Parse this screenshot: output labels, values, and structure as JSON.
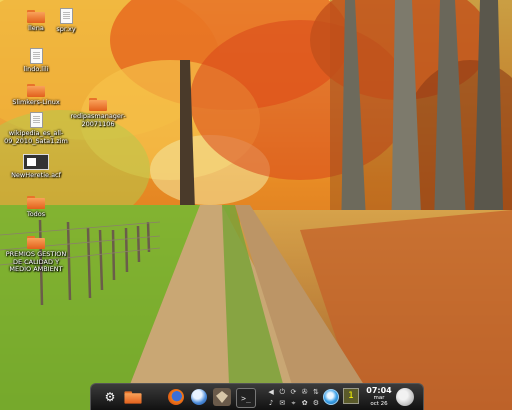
{
  "desktop": {
    "icons": [
      {
        "name": "folder-icon",
        "label": "llena"
      },
      {
        "name": "document-icon",
        "label": "spr.xy"
      },
      {
        "name": "document-icon",
        "label": "lindo.lili"
      },
      {
        "name": "folder-icon",
        "label": "Slimkers-Linux"
      },
      {
        "name": "document-icon",
        "label": "wikipedia_es_all-09_2010_Sata1.zim"
      },
      {
        "name": "folder-icon",
        "label": "redipasmanager-20071106"
      },
      {
        "name": "application-icon",
        "label": "NewHeretie.acf"
      },
      {
        "name": "folder-icon",
        "label": "Todos"
      },
      {
        "name": "folder-icon",
        "label": "PREMIOS GESTION DE CALIDAD Y MEDIO AMBIENT"
      }
    ]
  },
  "panel": {
    "launchers": [
      {
        "name": "kde-menu-icon",
        "glyph": "⚙"
      },
      {
        "name": "home-folder-icon"
      },
      {
        "name": "firefox-icon"
      },
      {
        "name": "network-browser-icon"
      },
      {
        "name": "virtualbox-icon"
      },
      {
        "name": "terminal-icon",
        "glyph": ">_"
      }
    ],
    "tray_glyphs": [
      "◀",
      "⏻",
      "⟳",
      "✇",
      "⇅",
      "♪",
      "✉",
      "⌖",
      "✿",
      "⚙"
    ],
    "notes_glyph": "1",
    "clock": {
      "time": "07:04",
      "day": "mar",
      "date": "oct 26"
    }
  }
}
